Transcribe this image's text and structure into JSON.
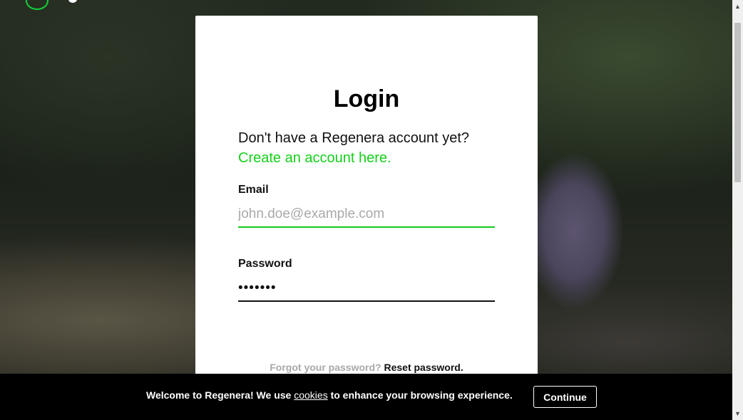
{
  "login": {
    "title": "Login",
    "prompt": "Don't have a Regenera account yet?",
    "create_link": "Create an account here.",
    "email_label": "Email",
    "email_placeholder": "john.doe@example.com",
    "password_label": "Password",
    "password_value": "•••••••",
    "forgot_text": "Forgot your password?",
    "reset_link": "Reset password."
  },
  "cookie": {
    "text_before": "Welcome to Regenera! We use ",
    "link": "cookies",
    "text_after": " to enhance your browsing experience.",
    "button": "Continue"
  },
  "colors": {
    "accent": "#14d01a",
    "cookie_bg": "#000000"
  },
  "icons": {
    "logo": "regenera-logo-icon",
    "scroll_up": "scroll-up-arrow-icon",
    "scroll_down": "scroll-down-arrow-icon"
  }
}
